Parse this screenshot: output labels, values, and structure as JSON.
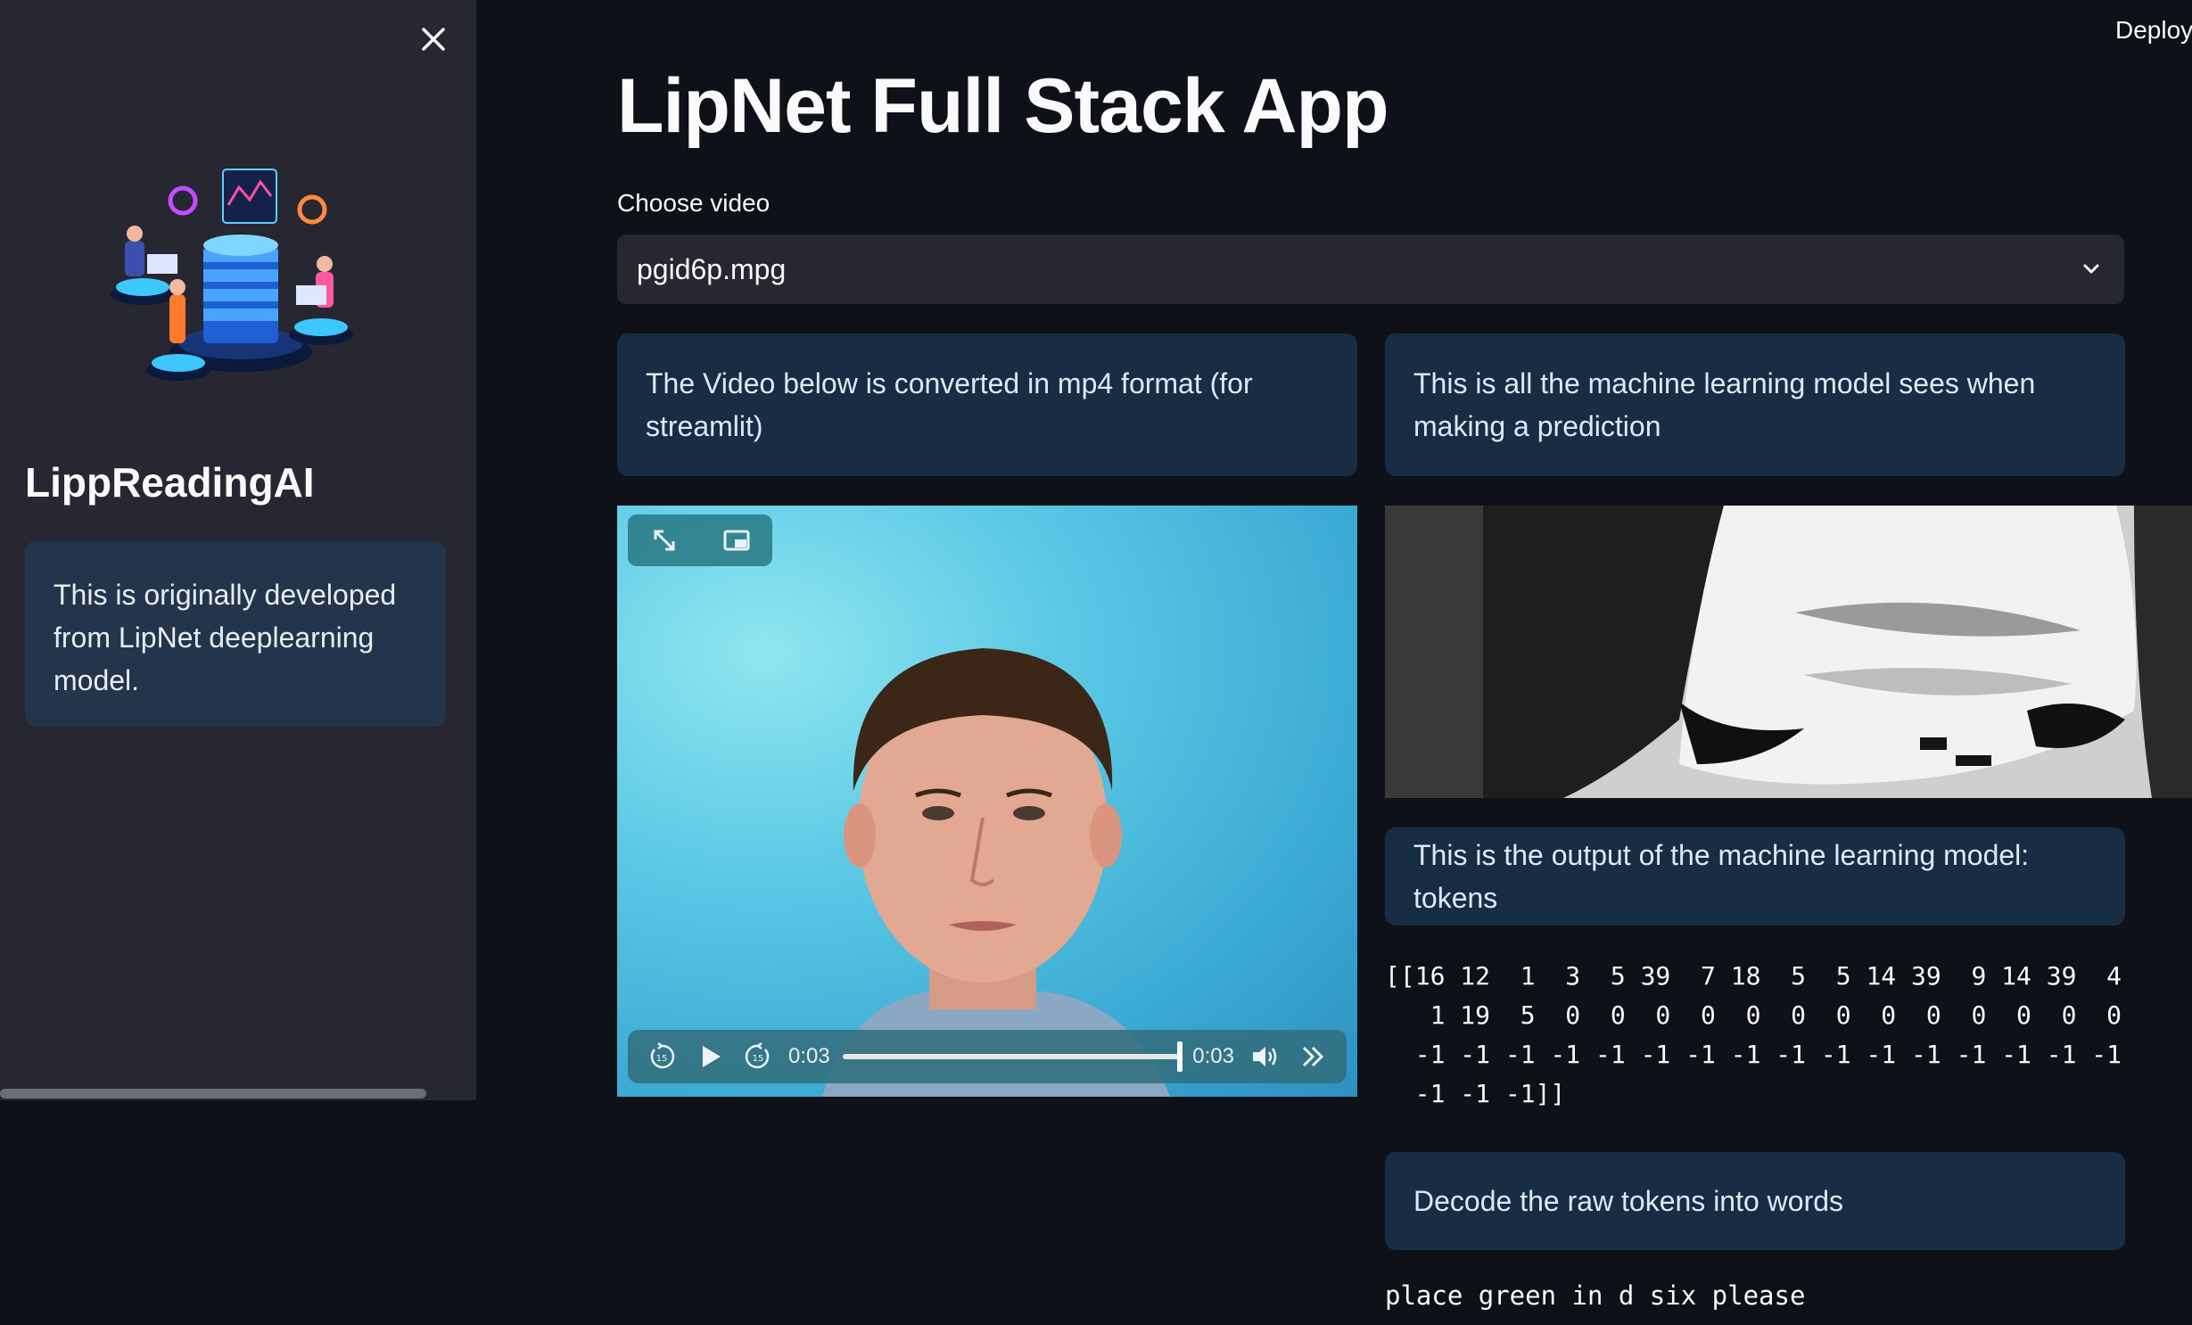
{
  "header": {
    "deploy_label": "Deploy"
  },
  "sidebar": {
    "title": "LippReadingAI",
    "info": "This is originally developed from LipNet deeplearning model."
  },
  "main": {
    "title": "LipNet Full Stack App",
    "select_label": "Choose video",
    "select_value": "pgid6p.mpg",
    "video_info": "The Video below is converted in mp4 format (for streamlit)",
    "model_info": "This is all the machine learning model sees when making a prediction",
    "output_info": "This is the output of the machine learning model: tokens",
    "tokens": "[[16 12  1  3  5 39  7 18  5  5 14 39  9 14 39  4\n   1 19  5  0  0  0  0  0  0  0  0  0  0  0  0  0\n  -1 -1 -1 -1 -1 -1 -1 -1 -1 -1 -1 -1 -1 -1 -1 -1\n  -1 -1 -1]]",
    "decode_info": "Decode the raw tokens into words",
    "decoded": "place green in d six please"
  },
  "video": {
    "current_time": "0:03",
    "duration": "0:03",
    "progress": 1.0
  },
  "colors": {
    "app_bg": "#0e1117",
    "sidebar_bg": "#262730",
    "info_bg": "#172d43",
    "info_text": "#dde9f5"
  }
}
